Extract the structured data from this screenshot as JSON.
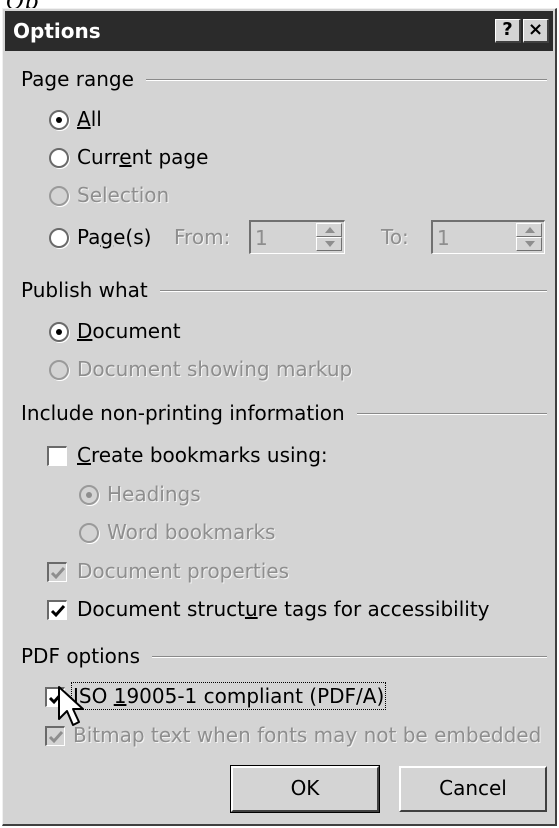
{
  "background_fragment": "Op",
  "dialog": {
    "title": "Options",
    "help_label": "?",
    "close_label": "×"
  },
  "page_range": {
    "label": "Page range",
    "all": "All",
    "current": "Current page",
    "selection": "Selection",
    "pages": "Page(s)",
    "from_label": "From:",
    "from_value": "1",
    "to_label": "To:",
    "to_value": "1"
  },
  "publish": {
    "label": "Publish what",
    "document": "Document",
    "markup": "Document showing markup"
  },
  "nonprint": {
    "label": "Include non-printing information",
    "bookmarks": "Create bookmarks using:",
    "headings": "Headings",
    "word_bookmarks": "Word bookmarks",
    "properties": "Document properties",
    "structure": "Document structure tags for accessibility"
  },
  "pdf": {
    "label": "PDF options",
    "iso": "ISO 19005-1 compliant (PDF/A)",
    "bitmap": "Bitmap text when fonts may not be embedded"
  },
  "buttons": {
    "ok": "OK",
    "cancel": "Cancel"
  },
  "state": {
    "page_range_selected": "All",
    "publish_selected": "Document",
    "bookmarks_mode_selected": "Headings",
    "create_bookmarks_checked": false,
    "document_properties_checked": true,
    "structure_tags_checked": true,
    "iso_checked": true,
    "bitmap_checked": true
  }
}
